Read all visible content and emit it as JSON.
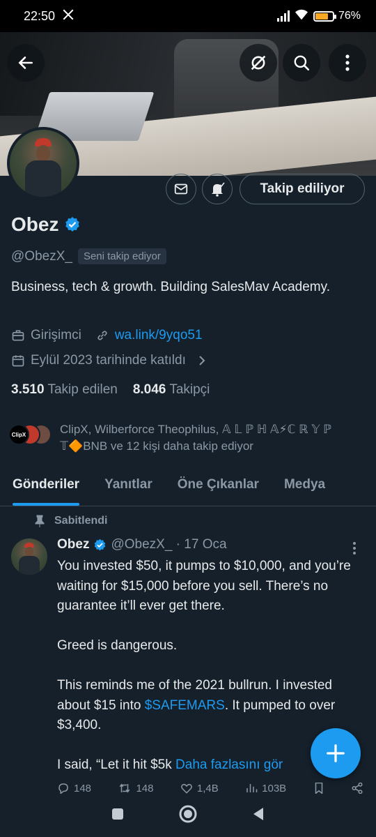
{
  "status": {
    "time": "22:50",
    "x_icon": "x-logo-icon",
    "battery": "76%",
    "battery_level": 0.76,
    "battery_color": "#f9a825"
  },
  "header": {
    "icons": [
      "back-arrow-icon",
      "grok-icon",
      "search-icon",
      "more-vertical-icon"
    ]
  },
  "profile": {
    "name": "Obez",
    "handle": "@ObezX_",
    "follows_you": "Seni takip ediyor",
    "follow_button": "Takip ediliyor",
    "bio": "Business, tech & growth. Building SalesMav Academy.",
    "category": "Girişimci",
    "link": "wa.link/9yqo51",
    "joined": "Eylül 2023 tarihinde katıldı",
    "following_count": "3.510",
    "following_label": "Takip edilen",
    "followers_count": "8.046",
    "followers_label": "Takipçi",
    "known_followers": "ClipX, Wilberforce Theophilus, 𝔸 𝕃 ℙ ℍ 𝔸⚡ℂ ℝ 𝕐 ℙ 𝕋🔶BNB ve 12 kişi daha takip ediyor",
    "mini_avatar_label": "ClipX"
  },
  "tabs": [
    {
      "label": "Gönderiler",
      "active": true
    },
    {
      "label": "Yanıtlar",
      "active": false
    },
    {
      "label": "Öne Çıkanlar",
      "active": false
    },
    {
      "label": "Medya",
      "active": false
    }
  ],
  "tweet": {
    "pinned_label": "Sabitlendi",
    "name": "Obez",
    "handle_date": "@ObezX_ · 17 Oca",
    "para1": "You invested $50, it pumps to $10,000, and you’re waiting for $15,000 before you sell. There’s no guarantee it’ll ever get there.",
    "para2": "Greed is dangerous.",
    "para3_a": "This reminds me of the 2021 bullrun. I invested about $15 into ",
    "cashtag": "$SAFEMARS",
    "para3_b": ". It pumped to over $3,400.",
    "para4": "I said, “Let it hit $5k ",
    "show_more": "Daha fazlasını gör",
    "replies": "148",
    "reposts": "148",
    "likes": "1,4B",
    "views": "103B"
  },
  "colors": {
    "background": "#15202b",
    "accent": "#1d9bf0",
    "secondary_text": "#8b98a5"
  }
}
